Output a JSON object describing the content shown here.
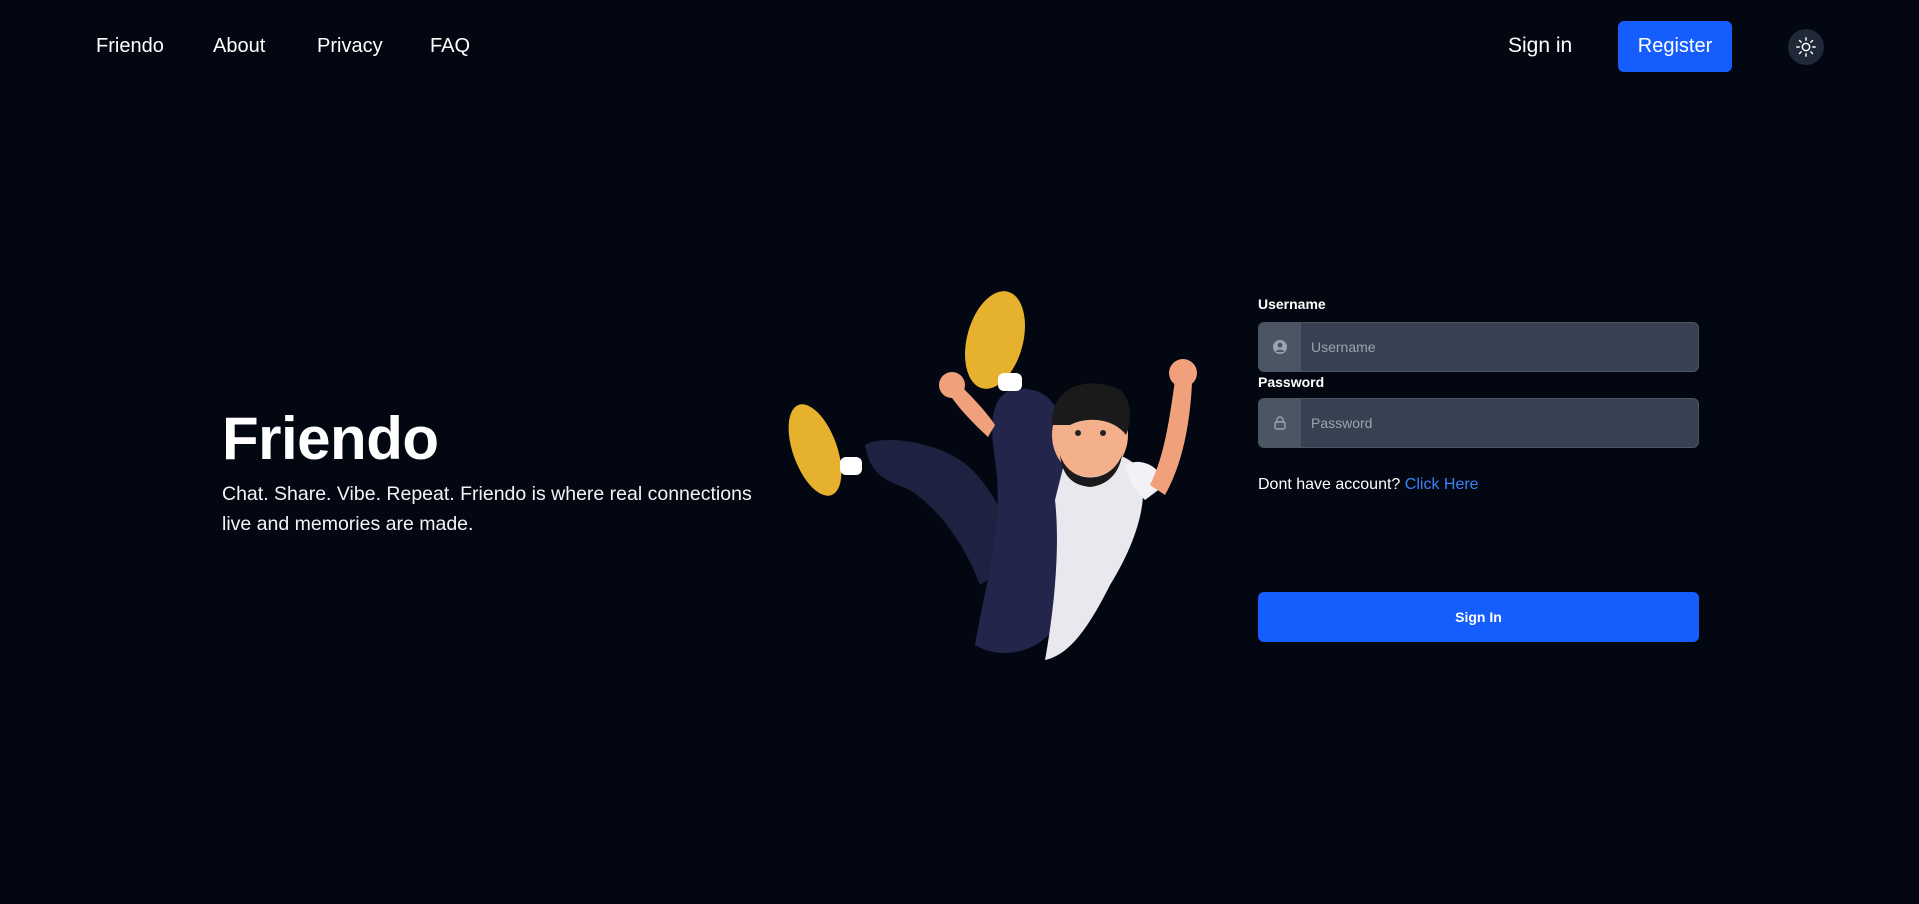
{
  "nav": {
    "brand": "Friendo",
    "links": [
      "About",
      "Privacy",
      "FAQ"
    ],
    "signin_label": "Sign in",
    "register_label": "Register",
    "theme_icon": "sun-icon"
  },
  "hero": {
    "title": "Friendo",
    "tagline": "Chat. Share. Vibe. Repeat. Friendo is where real connections live and memories are made."
  },
  "form": {
    "username_label": "Username",
    "username_placeholder": "Username",
    "username_icon": "user-circle-icon",
    "password_label": "Password",
    "password_placeholder": "Password",
    "password_icon": "lock-icon",
    "no_account_text": "Dont have account?",
    "click_here_label": "Click Here",
    "submit_label": "Sign In"
  },
  "colors": {
    "background": "#030712",
    "accent": "#155dfc",
    "input_bg": "#374151",
    "link": "#3b82f6"
  }
}
